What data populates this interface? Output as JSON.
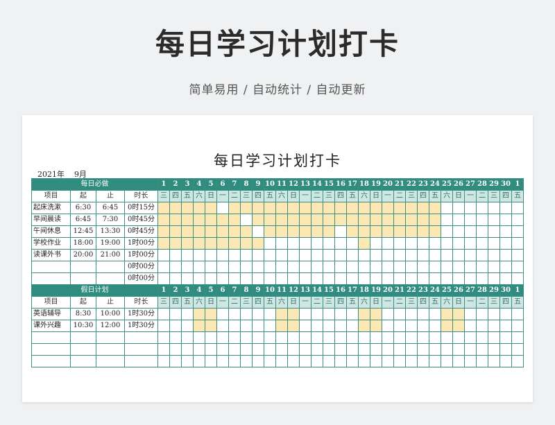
{
  "hero": {
    "title": "每日学习计划打卡",
    "subtitle": "简单易用  /  自动统计  /  自动更新"
  },
  "sheet": {
    "title": "每日学习计划打卡",
    "year": "2021年",
    "month": "9月"
  },
  "days": [
    "1",
    "2",
    "3",
    "4",
    "5",
    "6",
    "7",
    "8",
    "9",
    "10",
    "11",
    "12",
    "13",
    "14",
    "15",
    "16",
    "17",
    "18",
    "19",
    "20",
    "21",
    "22",
    "23",
    "24",
    "25",
    "26",
    "27",
    "28",
    "29",
    "30",
    "1"
  ],
  "weekdays": [
    "三",
    "四",
    "五",
    "六",
    "日",
    "一",
    "二",
    "三",
    "四",
    "五",
    "六",
    "日",
    "一",
    "二",
    "三",
    "四",
    "五",
    "六",
    "日",
    "一",
    "二",
    "三",
    "四",
    "五",
    "六",
    "日",
    "一",
    "二",
    "三",
    "四",
    "五"
  ],
  "headers": [
    "项目",
    "起",
    "止",
    "时长"
  ],
  "daily": {
    "section_label": "每日必做",
    "rows": [
      {
        "name": "起床洗漱",
        "start": "6:30",
        "end": "6:45",
        "duration": "0时15分",
        "checked": [
          1,
          1,
          1,
          1,
          1,
          0,
          1,
          1,
          1,
          1,
          1,
          1,
          1,
          1,
          1,
          1,
          1,
          1,
          1,
          1,
          1,
          1,
          1,
          1,
          0,
          0,
          0,
          0,
          0,
          0,
          0
        ]
      },
      {
        "name": "早间晨读",
        "start": "6:45",
        "end": "7:30",
        "duration": "0时45分",
        "checked": [
          1,
          1,
          1,
          1,
          1,
          1,
          1,
          0,
          1,
          1,
          1,
          1,
          1,
          1,
          1,
          1,
          1,
          1,
          1,
          1,
          1,
          1,
          1,
          1,
          0,
          0,
          0,
          0,
          0,
          0,
          0
        ]
      },
      {
        "name": "午间休息",
        "start": "12:45",
        "end": "13:30",
        "duration": "0时45分",
        "checked": [
          1,
          1,
          1,
          1,
          1,
          1,
          1,
          1,
          0,
          1,
          1,
          1,
          1,
          1,
          1,
          0,
          1,
          1,
          1,
          1,
          1,
          1,
          1,
          1,
          0,
          0,
          0,
          0,
          0,
          0,
          0
        ]
      },
      {
        "name": "学校作业",
        "start": "18:00",
        "end": "19:00",
        "duration": "1时00分",
        "checked": [
          1,
          1,
          1,
          1,
          1,
          1,
          1,
          1,
          1,
          0,
          0,
          0,
          0,
          0,
          0,
          0,
          0,
          1,
          0,
          0,
          0,
          0,
          0,
          0,
          0,
          0,
          0,
          0,
          0,
          0,
          0
        ]
      },
      {
        "name": "读课外书",
        "start": "20:00",
        "end": "21:00",
        "duration": "1时00分",
        "checked": [
          0,
          0,
          0,
          0,
          0,
          0,
          0,
          0,
          0,
          0,
          0,
          0,
          0,
          0,
          0,
          0,
          0,
          0,
          0,
          0,
          0,
          0,
          0,
          0,
          0,
          0,
          0,
          0,
          0,
          0,
          0
        ]
      },
      {
        "name": "",
        "start": "",
        "end": "",
        "duration": "0时00分",
        "checked": [
          0,
          0,
          0,
          0,
          0,
          0,
          0,
          0,
          0,
          0,
          0,
          0,
          0,
          0,
          0,
          0,
          0,
          0,
          0,
          0,
          0,
          0,
          0,
          0,
          0,
          0,
          0,
          0,
          0,
          0,
          0
        ]
      },
      {
        "name": "",
        "start": "",
        "end": "",
        "duration": "0时00分",
        "checked": [
          0,
          0,
          0,
          0,
          0,
          0,
          0,
          0,
          0,
          0,
          0,
          0,
          0,
          0,
          0,
          0,
          0,
          0,
          0,
          0,
          0,
          0,
          0,
          0,
          0,
          0,
          0,
          0,
          0,
          0,
          0
        ]
      }
    ]
  },
  "holiday": {
    "section_label": "假日计划",
    "rows": [
      {
        "name": "英语辅导",
        "start": "8:30",
        "end": "10:00",
        "duration": "1时30分",
        "checked": [
          0,
          0,
          0,
          1,
          1,
          0,
          0,
          0,
          0,
          0,
          1,
          1,
          0,
          0,
          0,
          0,
          0,
          1,
          1,
          0,
          0,
          0,
          0,
          0,
          1,
          1,
          0,
          0,
          0,
          0,
          0
        ]
      },
      {
        "name": "课外兴趣",
        "start": "10:30",
        "end": "12:00",
        "duration": "1时30分",
        "checked": [
          0,
          0,
          0,
          1,
          1,
          0,
          0,
          0,
          0,
          0,
          1,
          1,
          0,
          0,
          0,
          0,
          0,
          1,
          1,
          0,
          0,
          0,
          0,
          0,
          1,
          1,
          0,
          0,
          0,
          0,
          0
        ]
      },
      {
        "name": "",
        "start": "",
        "end": "",
        "duration": "",
        "checked": [
          0,
          0,
          0,
          0,
          0,
          0,
          0,
          0,
          0,
          0,
          0,
          0,
          0,
          0,
          0,
          0,
          0,
          0,
          0,
          0,
          0,
          0,
          0,
          0,
          0,
          0,
          0,
          0,
          0,
          0,
          0
        ]
      },
      {
        "name": "",
        "start": "",
        "end": "",
        "duration": "",
        "checked": [
          0,
          0,
          0,
          0,
          0,
          0,
          0,
          0,
          0,
          0,
          0,
          0,
          0,
          0,
          0,
          0,
          0,
          0,
          0,
          0,
          0,
          0,
          0,
          0,
          0,
          0,
          0,
          0,
          0,
          0,
          0
        ]
      },
      {
        "name": "",
        "start": "",
        "end": "",
        "duration": "",
        "checked": [
          0,
          0,
          0,
          0,
          0,
          0,
          0,
          0,
          0,
          0,
          0,
          0,
          0,
          0,
          0,
          0,
          0,
          0,
          0,
          0,
          0,
          0,
          0,
          0,
          0,
          0,
          0,
          0,
          0,
          0,
          0
        ]
      }
    ]
  },
  "colors": {
    "header_teal": "#2f8c7f",
    "weekday_bg": "#cfe7e3",
    "checked_fill": "#fce8b2",
    "grid_line": "#3a8e83"
  }
}
